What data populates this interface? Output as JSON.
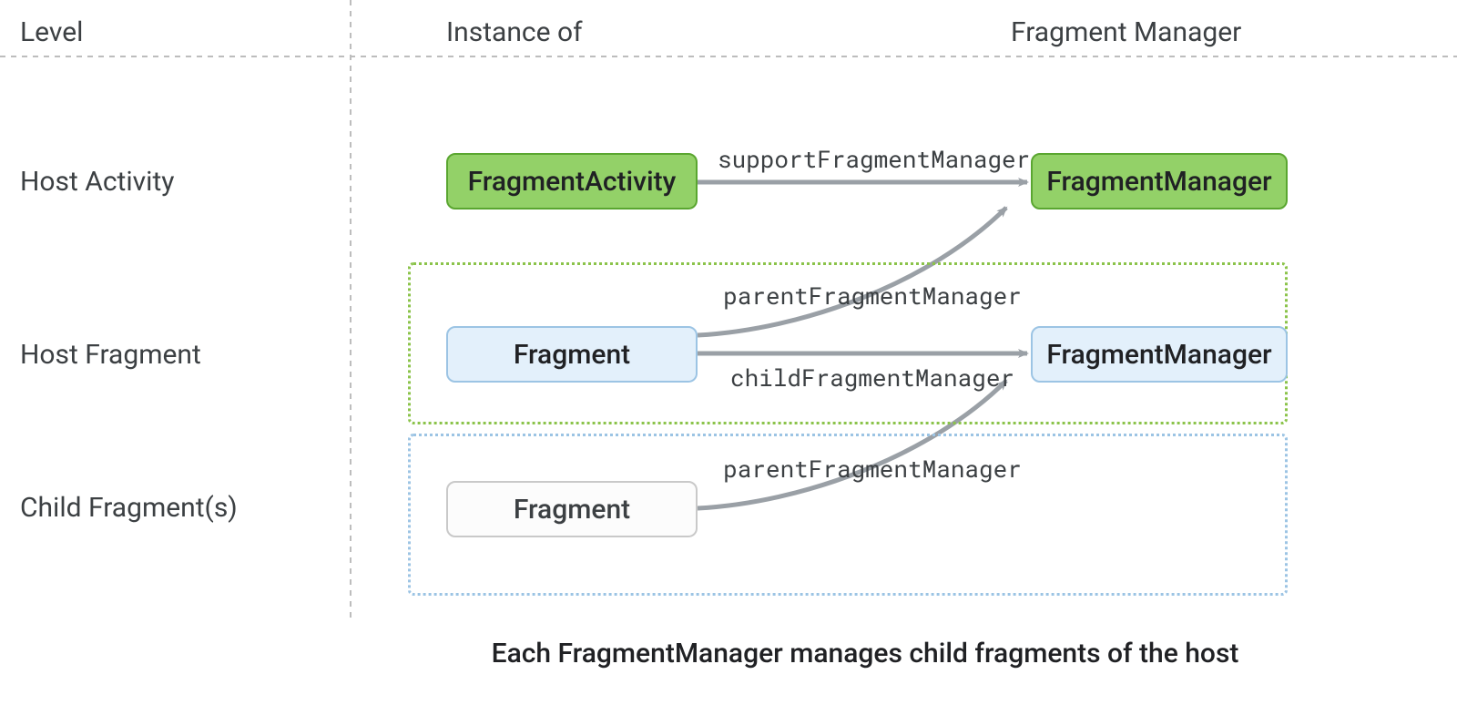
{
  "headers": {
    "level": "Level",
    "instance_of": "Instance of",
    "fragment_manager": "Fragment Manager"
  },
  "rows": {
    "host_activity": "Host Activity",
    "host_fragment": "Host Fragment",
    "child_fragments": "Child Fragment(s)"
  },
  "nodes": {
    "fragment_activity": "FragmentActivity",
    "fm_green": "FragmentManager",
    "fragment_host": "Fragment",
    "fm_blue": "FragmentManager",
    "fragment_child": "Fragment"
  },
  "arrows": {
    "support_fm": "supportFragmentManager",
    "parent_fm_1": "parentFragmentManager",
    "child_fm": "childFragmentManager",
    "parent_fm_2": "parentFragmentManager"
  },
  "caption": "Each FragmentManager manages child fragments of the host"
}
